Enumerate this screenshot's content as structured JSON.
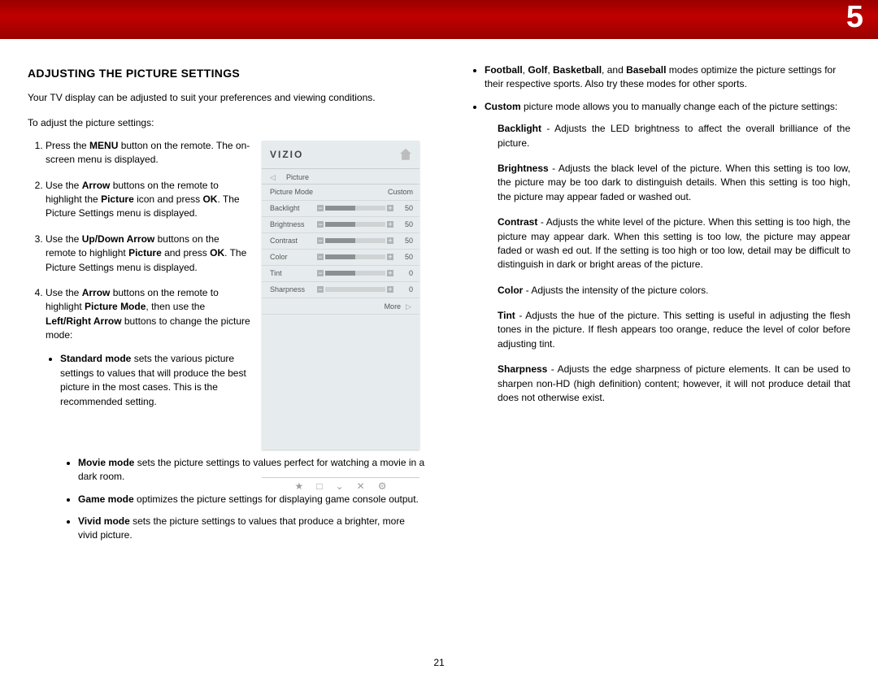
{
  "chapter_number": "5",
  "page_number": "21",
  "left": {
    "heading": "ADJUSTING THE PICTURE SETTINGS",
    "intro": "Your TV display can be adjusted to suit your preferences and viewing conditions.",
    "lead_in": "To adjust the picture settings:",
    "steps": {
      "s1_a": "Press the ",
      "s1_b": "MENU",
      "s1_c": " button on the remote. The on-screen menu is displayed.",
      "s2_a": "Use the ",
      "s2_b": "Arrow",
      "s2_c": " buttons on the remote to highlight the ",
      "s2_d": "Picture",
      "s2_e": " icon and press ",
      "s2_f": "OK",
      "s2_g": ". The Picture Settings menu is displayed.",
      "s3_a": "Use the ",
      "s3_b": "Up/Down Arrow",
      "s3_c": " buttons on the remote to highlight ",
      "s3_d": "Picture",
      "s3_e": " and press ",
      "s3_f": "OK",
      "s3_g": ". The Picture Settings menu is displayed.",
      "s4_a": "Use the ",
      "s4_b": "Arrow",
      "s4_c": " buttons on the remote to highlight ",
      "s4_d": "Picture Mode",
      "s4_e": ", then use the ",
      "s4_f": "Left/Right Arrow",
      "s4_g": " buttons to change the picture mode:"
    },
    "modes": {
      "std_b": "Standard mode",
      "std_t": " sets the various picture settings to values that will produce the best picture in the most cases. This is the recommended setting.",
      "mov_b": "Movie mode",
      "mov_t": " sets the picture settings to values perfect for watching a movie in a dark room.",
      "gam_b": "Game mode",
      "gam_t": " optimizes the picture settings for displaying game console output.",
      "viv_b": "Vivid mode",
      "viv_t": " sets the picture settings to values that produce a brighter, more vivid picture."
    }
  },
  "right": {
    "sports_b1": "Football",
    "sports_s1": ", ",
    "sports_b2": "Golf",
    "sports_s2": ", ",
    "sports_b3": "Basketball",
    "sports_s3": ", and ",
    "sports_b4": "Baseball",
    "sports_t": " modes optimize the picture settings for their respective sports. Also try these modes for other sports.",
    "custom_b": "Custom",
    "custom_t": " picture mode allows you to manually change each of the picture settings:",
    "defs": {
      "backlight_b": "Backlight",
      "backlight_t": " - Adjusts the LED brightness to affect the overall brilliance of the picture.",
      "brightness_b": "Brightness",
      "brightness_t": " - Adjusts the black level of the picture. When this setting is too low, the picture may be too dark to distinguish details. When this setting is too high, the picture may appear faded or washed out.",
      "contrast_b": "Contrast",
      "contrast_t": " - Adjusts the white level of the picture. When this setting is too high, the picture may appear dark. When this setting is too low, the picture may appear faded or wash ed out. If the setting is too high or too low, detail may be difficult to distinguish in dark or bright areas of the picture.",
      "color_b": "Color",
      "color_t": " - Adjusts the intensity of the picture colors.",
      "tint_b": "Tint",
      "tint_t": " - Adjusts the hue of the picture. This setting is useful in adjusting the flesh tones in the picture. If flesh appears too orange, reduce the level of color before adjusting tint.",
      "sharp_b": "Sharpness",
      "sharp_t": " - Adjusts the edge sharpness of picture elements. It can be used to sharpen non-HD (high definition) content; however, it will not produce detail that does not otherwise exist."
    }
  },
  "osd": {
    "logo": "VIZIO",
    "category": "Picture",
    "more": "More",
    "rows": [
      {
        "label": "Picture Mode",
        "value": "Custom",
        "type": "text"
      },
      {
        "label": "Backlight",
        "value": "50",
        "type": "slider",
        "pct": 50
      },
      {
        "label": "Brightness",
        "value": "50",
        "type": "slider",
        "pct": 50
      },
      {
        "label": "Contrast",
        "value": "50",
        "type": "slider",
        "pct": 50
      },
      {
        "label": "Color",
        "value": "50",
        "type": "slider",
        "pct": 50
      },
      {
        "label": "Tint",
        "value": "0",
        "type": "slider",
        "pct": 50
      },
      {
        "label": "Sharpness",
        "value": "0",
        "type": "slider",
        "pct": 0
      }
    ],
    "icons": [
      "★",
      "□",
      "⌄",
      "✕",
      "⚙"
    ]
  }
}
